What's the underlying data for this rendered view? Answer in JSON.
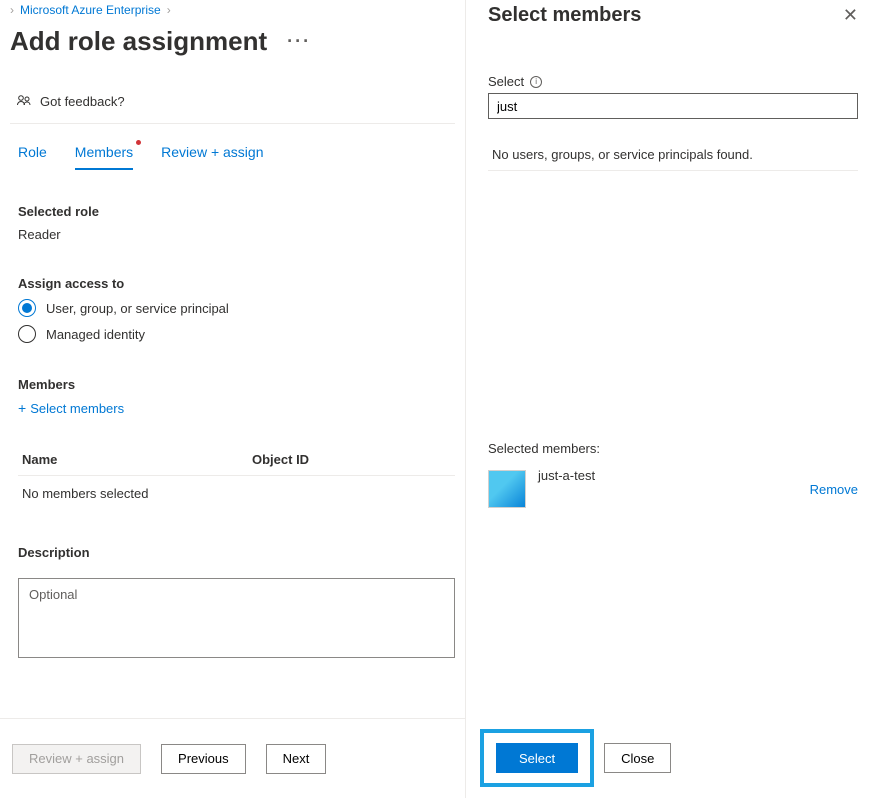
{
  "breadcrumb": {
    "item": "Microsoft Azure Enterprise"
  },
  "page": {
    "title": "Add role assignment",
    "feedback": "Got feedback?"
  },
  "tabs": {
    "role": "Role",
    "members": "Members",
    "review": "Review + assign"
  },
  "selected_role": {
    "heading": "Selected role",
    "value": "Reader"
  },
  "assign_to": {
    "heading": "Assign access to",
    "opt_user": "User, group, or service principal",
    "opt_managed": "Managed identity"
  },
  "members": {
    "heading": "Members",
    "add_link": "Select members"
  },
  "table": {
    "col_name": "Name",
    "col_obj": "Object ID",
    "empty": "No members selected"
  },
  "description": {
    "heading": "Description",
    "placeholder": "Optional"
  },
  "footer": {
    "review": "Review + assign",
    "prev": "Previous",
    "next": "Next"
  },
  "panel": {
    "title": "Select members",
    "field_label": "Select",
    "search_value": "just",
    "no_results": "No users, groups, or service principals found.",
    "selected_heading": "Selected members:",
    "member_name": "just-a-test",
    "remove": "Remove",
    "select_btn": "Select",
    "close_btn": "Close"
  }
}
